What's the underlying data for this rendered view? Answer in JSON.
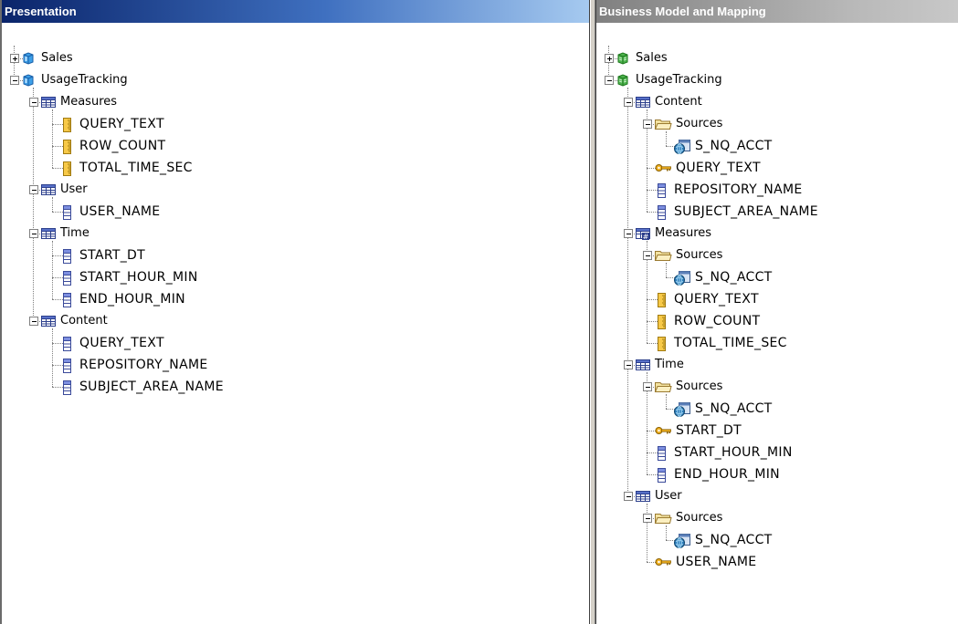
{
  "presentation": {
    "title": "Presentation",
    "tree": [
      {
        "label": "Sales",
        "icon": "presentation-catalog-icon",
        "expanded": false,
        "level": 0,
        "kind": "catalog"
      },
      {
        "label": "UsageTracking",
        "icon": "presentation-catalog-icon",
        "expanded": true,
        "level": 0,
        "kind": "catalog"
      },
      {
        "label": "Measures",
        "icon": "table-icon",
        "expanded": true,
        "level": 1,
        "kind": "table"
      },
      {
        "label": "QUERY_TEXT",
        "icon": "measure-column-icon",
        "level": 2,
        "kind": "measure"
      },
      {
        "label": "ROW_COUNT",
        "icon": "measure-column-icon",
        "level": 2,
        "kind": "measure"
      },
      {
        "label": "TOTAL_TIME_SEC",
        "icon": "measure-column-icon",
        "level": 2,
        "kind": "measure"
      },
      {
        "label": "User",
        "icon": "table-icon",
        "expanded": true,
        "level": 1,
        "kind": "table"
      },
      {
        "label": "USER_NAME",
        "icon": "column-icon",
        "level": 2,
        "kind": "column"
      },
      {
        "label": "Time",
        "icon": "table-icon",
        "expanded": true,
        "level": 1,
        "kind": "table"
      },
      {
        "label": "START_DT",
        "icon": "column-icon",
        "level": 2,
        "kind": "column"
      },
      {
        "label": "START_HOUR_MIN",
        "icon": "column-icon",
        "level": 2,
        "kind": "column"
      },
      {
        "label": "END_HOUR_MIN",
        "icon": "column-icon",
        "level": 2,
        "kind": "column"
      },
      {
        "label": "Content",
        "icon": "table-icon",
        "expanded": true,
        "level": 1,
        "kind": "table"
      },
      {
        "label": "QUERY_TEXT",
        "icon": "column-icon",
        "level": 2,
        "kind": "column"
      },
      {
        "label": "REPOSITORY_NAME",
        "icon": "column-icon",
        "level": 2,
        "kind": "column"
      },
      {
        "label": "SUBJECT_AREA_NAME",
        "icon": "column-icon",
        "level": 2,
        "kind": "column"
      }
    ]
  },
  "bmm": {
    "title": "Business Model and Mapping",
    "tree": [
      {
        "label": "Sales",
        "icon": "business-model-icon",
        "expanded": false,
        "level": 0,
        "kind": "model"
      },
      {
        "label": "UsageTracking",
        "icon": "business-model-icon",
        "expanded": true,
        "level": 0,
        "kind": "model"
      },
      {
        "label": "Content",
        "icon": "table-icon",
        "expanded": true,
        "level": 1,
        "kind": "table"
      },
      {
        "label": "Sources",
        "icon": "folder-icon",
        "expanded": true,
        "level": 2,
        "kind": "folder"
      },
      {
        "label": "S_NQ_ACCT",
        "icon": "logical-source-icon",
        "level": 3,
        "kind": "source"
      },
      {
        "label": "QUERY_TEXT",
        "icon": "key-column-icon",
        "level": 2,
        "kind": "key"
      },
      {
        "label": "REPOSITORY_NAME",
        "icon": "column-icon",
        "level": 2,
        "kind": "column"
      },
      {
        "label": "SUBJECT_AREA_NAME",
        "icon": "column-icon",
        "level": 2,
        "kind": "column"
      },
      {
        "label": "Measures",
        "icon": "fact-table-icon",
        "expanded": true,
        "level": 1,
        "kind": "facttable"
      },
      {
        "label": "Sources",
        "icon": "folder-icon",
        "expanded": true,
        "level": 2,
        "kind": "folder"
      },
      {
        "label": "S_NQ_ACCT",
        "icon": "logical-source-icon",
        "level": 3,
        "kind": "source"
      },
      {
        "label": "QUERY_TEXT",
        "icon": "measure-column-icon",
        "level": 2,
        "kind": "measure"
      },
      {
        "label": "ROW_COUNT",
        "icon": "measure-column-icon",
        "level": 2,
        "kind": "measure"
      },
      {
        "label": "TOTAL_TIME_SEC",
        "icon": "measure-column-icon",
        "level": 2,
        "kind": "measure"
      },
      {
        "label": "Time",
        "icon": "table-icon",
        "expanded": true,
        "level": 1,
        "kind": "table"
      },
      {
        "label": "Sources",
        "icon": "folder-icon",
        "expanded": true,
        "level": 2,
        "kind": "folder"
      },
      {
        "label": "S_NQ_ACCT",
        "icon": "logical-source-icon",
        "level": 3,
        "kind": "source"
      },
      {
        "label": "START_DT",
        "icon": "key-column-icon",
        "level": 2,
        "kind": "key"
      },
      {
        "label": "START_HOUR_MIN",
        "icon": "column-icon",
        "level": 2,
        "kind": "column"
      },
      {
        "label": "END_HOUR_MIN",
        "icon": "column-icon",
        "level": 2,
        "kind": "column"
      },
      {
        "label": "User",
        "icon": "table-icon",
        "expanded": true,
        "level": 1,
        "kind": "table"
      },
      {
        "label": "Sources",
        "icon": "folder-icon",
        "expanded": true,
        "level": 2,
        "kind": "folder"
      },
      {
        "label": "S_NQ_ACCT",
        "icon": "logical-source-icon",
        "level": 3,
        "kind": "source"
      },
      {
        "label": "USER_NAME",
        "icon": "key-column-icon",
        "level": 2,
        "kind": "key"
      }
    ]
  }
}
